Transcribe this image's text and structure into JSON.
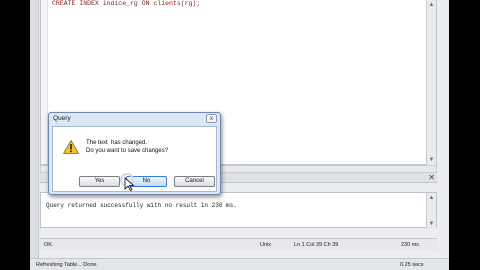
{
  "editor": {
    "code_line": "CREATE INDEX indice_rg ON clients(rg);"
  },
  "output": {
    "message": "Query returned successfully with no result in 230 ms."
  },
  "status": {
    "left": "OK.",
    "line_ending": "Unix",
    "position": "Ln 1 Col 39 Ch 39",
    "time": "230 ms"
  },
  "bottom_status": {
    "left": "Refreshing Table... Done.",
    "right": "0.25 secs"
  },
  "dialog": {
    "title": "Query",
    "close_label": "x",
    "line1": "The text  has changed.",
    "line2": "Do you want to save changes?",
    "buttons": {
      "yes": "Yes",
      "no": "No",
      "cancel": "Cancel"
    }
  },
  "icons": [
    "warning-icon",
    "close-icon",
    "scroll-up-icon",
    "scroll-down-icon",
    "mouse-cursor-icon"
  ],
  "colors": {
    "code_text": "#8a1b1b",
    "dialog_frame": "#dce7f5",
    "default_button": "#3a7bd5"
  }
}
